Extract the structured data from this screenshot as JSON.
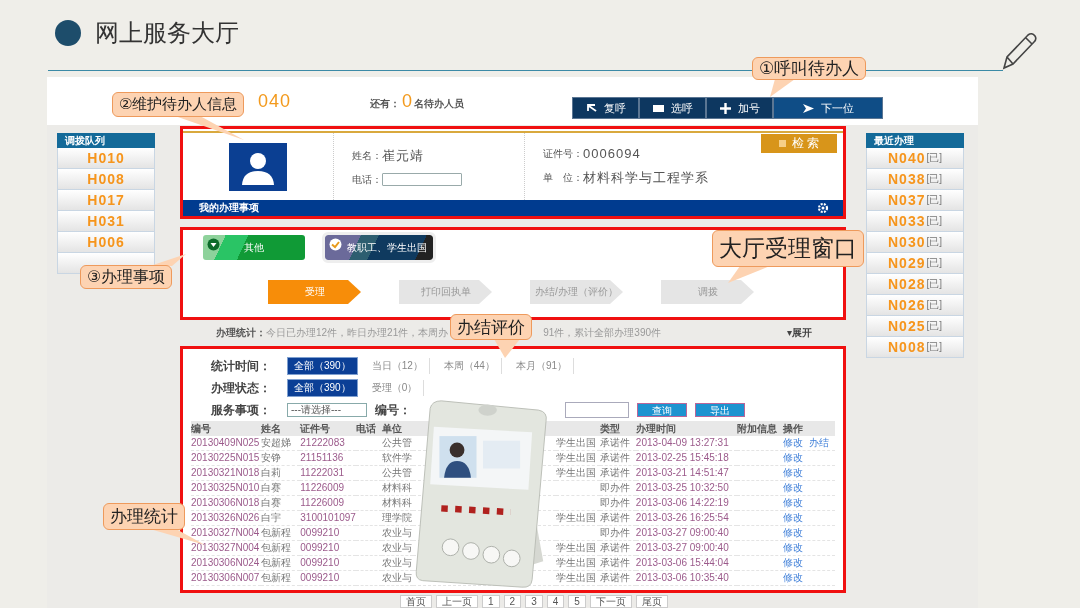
{
  "slide": {
    "title": "网上服务大厅"
  },
  "topbar": {
    "current": "040",
    "waiting_label": "还有：",
    "waiting_count": "0",
    "waiting_suffix": "名待办人员",
    "buttons": [
      {
        "label": "复呼"
      },
      {
        "label": "选呼"
      },
      {
        "label": "加号"
      },
      {
        "label": "下一位"
      }
    ]
  },
  "queue": {
    "title": "调拨队列",
    "items": [
      "H010",
      "H008",
      "H017",
      "H031",
      "H006"
    ]
  },
  "person": {
    "name_label": "姓名：",
    "name": "崔元靖",
    "phone_label": "电话：",
    "id_label": "证件号：",
    "id": "0006094",
    "unit_label": "单　位：",
    "unit": "材料科学与工程学系",
    "search_button": "检 索",
    "bar_title": "我的办理事项"
  },
  "matters": {
    "tiles": [
      {
        "label": "其他",
        "kind": "green"
      },
      {
        "label": "教职工、学生出国",
        "kind": "dark"
      }
    ],
    "steps": [
      {
        "label": "受理",
        "selected": true
      },
      {
        "label": "打印回执单",
        "selected": false
      },
      {
        "label": "办结/办理（评价）",
        "selected": false
      },
      {
        "label": "调拨",
        "selected": false
      }
    ]
  },
  "summary": {
    "label": "办理统计：",
    "text_1": "今日已办理12件，昨日办理21件，本周办",
    "text_2": "91件，累计全部办理390件",
    "toggle": "▾展开"
  },
  "stats": {
    "time_label": "统计时间：",
    "time_filters": [
      {
        "text": "全部（390）",
        "selected": true
      },
      {
        "text": "当日（12）",
        "selected": false
      },
      {
        "text": "本周（44）",
        "selected": false
      },
      {
        "text": "本月（91）",
        "selected": false
      }
    ],
    "status_label": "办理状态：",
    "status_filters": [
      {
        "text": "全部（390）",
        "selected": true
      },
      {
        "text": "受理（0）",
        "selected": false
      }
    ],
    "service_label": "服务事项：",
    "service_select": "---请选择---",
    "number_label": "编号：",
    "query_button": "查询",
    "export_button": "导出",
    "table": {
      "columns": [
        "编号",
        "姓名",
        "证件号",
        "电话",
        "单位",
        "类型",
        "办理时间",
        "附加信息",
        "操作"
      ],
      "rows": [
        {
          "number": "20130409N025",
          "name": "安超娣",
          "id": "21222083",
          "unit": "公共管",
          "column_6": "学生出国",
          "type": "承诺件",
          "time": "2013-04-09 13:27:31",
          "actions": [
            "修改",
            "办结"
          ]
        },
        {
          "number": "20130225N015",
          "name": "安铮",
          "id": "21151136",
          "unit": "软件学",
          "column_6": "学生出国",
          "type": "承诺件",
          "time": "2013-02-25 15:45:18",
          "actions": [
            "修改"
          ]
        },
        {
          "number": "20130321N018",
          "name": "白莉",
          "id": "11222031",
          "unit": "公共管",
          "column_6": "学生出国",
          "type": "承诺件",
          "time": "2013-03-21 14:51:47",
          "actions": [
            "修改"
          ]
        },
        {
          "number": "20130325N010",
          "name": "白赛",
          "id": "11226009",
          "unit": "材料科",
          "type": "即办件",
          "time": "2013-03-25 10:32:50",
          "actions": [
            "修改"
          ]
        },
        {
          "number": "20130306N018",
          "name": "白赛",
          "id": "11226009",
          "unit": "材料科",
          "type": "即办件",
          "time": "2013-03-06 14:22:19",
          "actions": [
            "修改"
          ]
        },
        {
          "number": "20130326N026",
          "name": "白宇",
          "id": "3100101097",
          "unit": "理学院",
          "column_6": "学生出国",
          "type": "承诺件",
          "time": "2013-03-26 16:25:54",
          "actions": [
            "修改"
          ]
        },
        {
          "number": "20130327N004",
          "name": "包新程",
          "id": "0099210",
          "unit": "农业与",
          "type": "即办件",
          "time": "2013-03-27 09:00:40",
          "actions": [
            "修改"
          ]
        },
        {
          "number": "20130327N004",
          "name": "包新程",
          "id": "0099210",
          "unit": "农业与",
          "column_6": "学生出国",
          "type": "承诺件",
          "time": "2013-03-27 09:00:40",
          "actions": [
            "修改"
          ]
        },
        {
          "number": "20130306N024",
          "name": "包新程",
          "id": "0099210",
          "unit": "农业与",
          "column_6": "学生出国",
          "type": "承诺件",
          "time": "2013-03-06 15:44:04",
          "actions": [
            "修改"
          ]
        },
        {
          "number": "20130306N007",
          "name": "包新程",
          "id": "0099210",
          "unit": "农业与",
          "column_6": "学生出国",
          "type": "承诺件",
          "time": "2013-03-06 10:35:40",
          "actions": [
            "修改"
          ]
        }
      ]
    }
  },
  "pagination": [
    "首页",
    "上一页",
    "1",
    "2",
    "3",
    "4",
    "5",
    "下一页",
    "尾页"
  ],
  "recent": {
    "title": "最近办理",
    "items": [
      {
        "code": "N040",
        "tag": "[已]"
      },
      {
        "code": "N038",
        "tag": "[已]"
      },
      {
        "code": "N037",
        "tag": "[已]"
      },
      {
        "code": "N033",
        "tag": "[已]"
      },
      {
        "code": "N030",
        "tag": "[已]"
      },
      {
        "code": "N029",
        "tag": "[已]"
      },
      {
        "code": "N028",
        "tag": "[已]"
      },
      {
        "code": "N026",
        "tag": "[已]"
      },
      {
        "code": "N025",
        "tag": "[已]"
      },
      {
        "code": "N008",
        "tag": "[已]"
      }
    ]
  },
  "callouts": [
    "①呼叫待办人",
    "②维护待办人信息",
    "③办理事项",
    "大厅受理窗口",
    "办结评价",
    "办理统计"
  ]
}
